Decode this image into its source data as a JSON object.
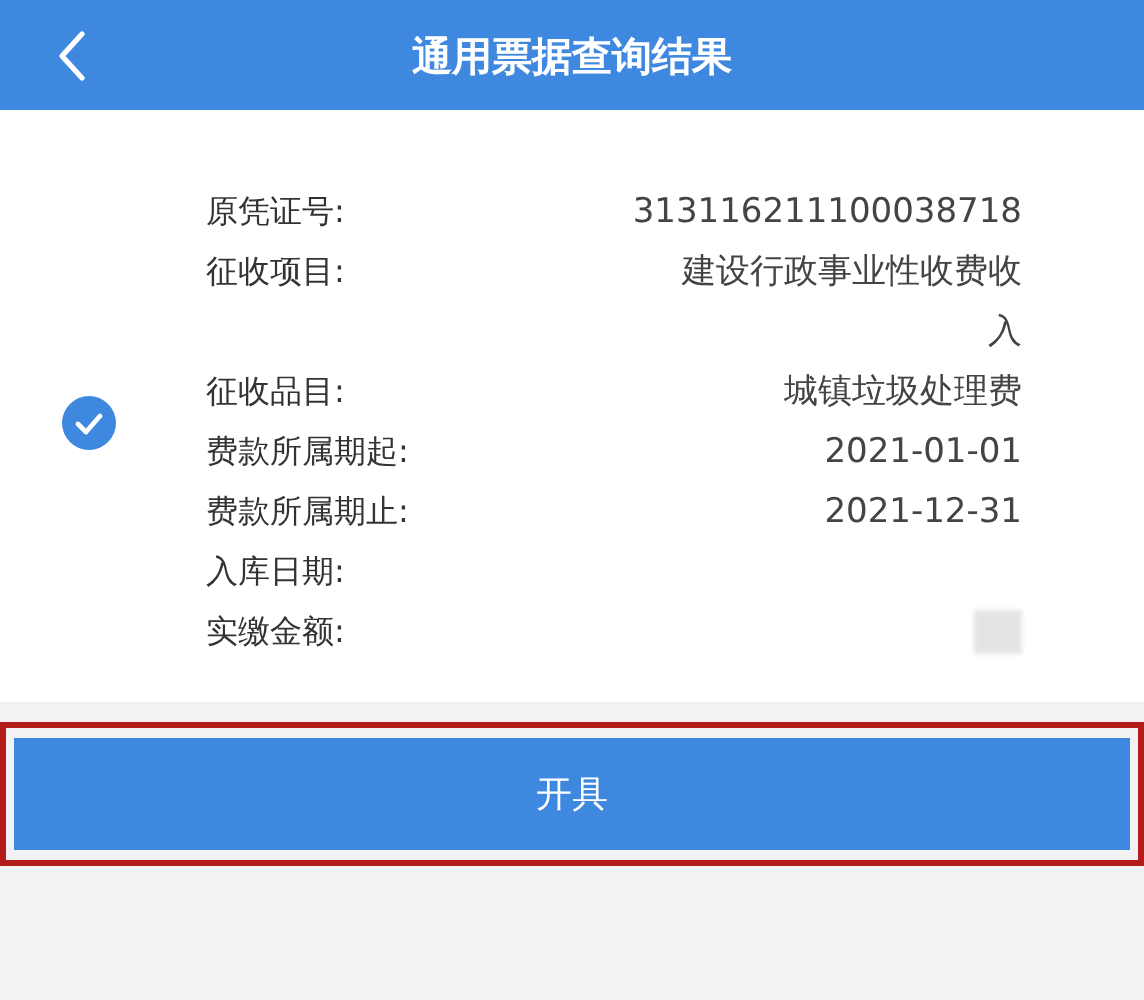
{
  "header": {
    "title": "通用票据查询结果"
  },
  "record": {
    "selected": true,
    "fields": [
      {
        "label": "原凭证号:",
        "value": "313116211100038718"
      },
      {
        "label": "征收项目:",
        "value": "建设行政事业性收费收入"
      },
      {
        "label": "征收品目:",
        "value": "城镇垃圾处理费"
      },
      {
        "label": "费款所属期起:",
        "value": "2021-01-01"
      },
      {
        "label": "费款所属期止:",
        "value": "2021-12-31"
      },
      {
        "label": "入库日期:"
      },
      {
        "label": "实缴金额:",
        "redacted": true
      }
    ]
  },
  "action": {
    "label": "开具",
    "highlighted": true
  }
}
